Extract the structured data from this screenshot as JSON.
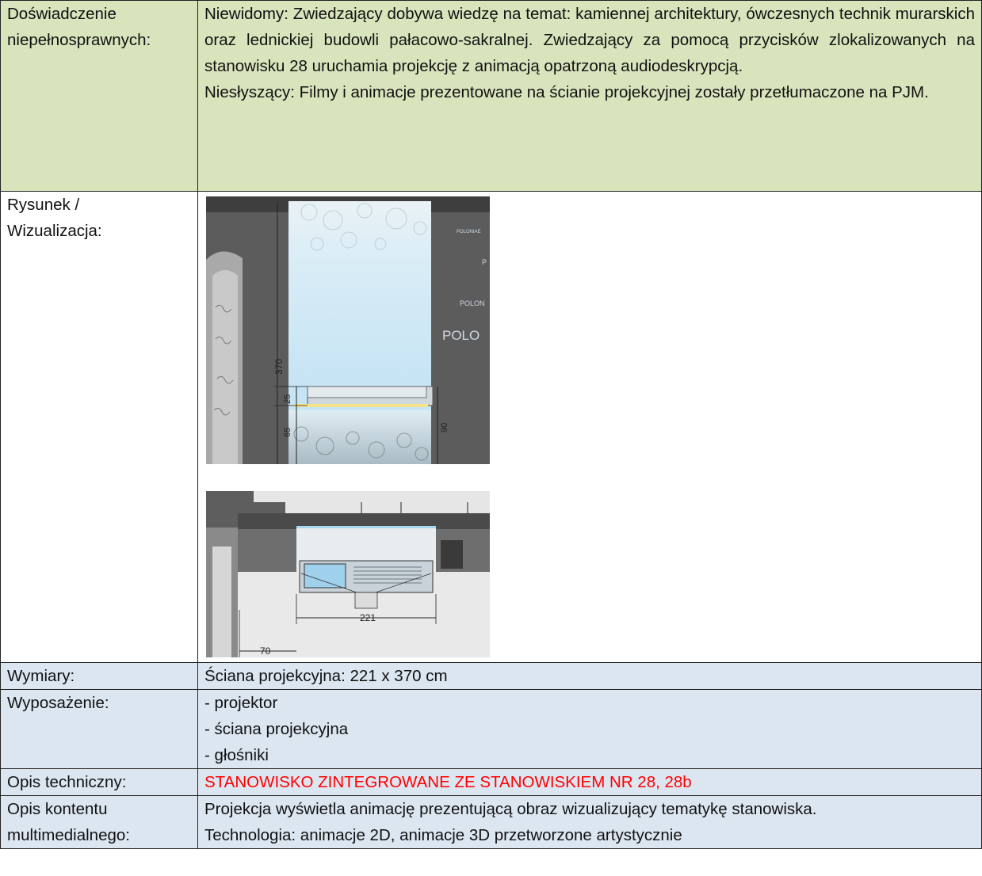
{
  "rows": {
    "experience": {
      "label_line1": "Doświadczenie",
      "label_line2": "niepełnosprawnych:",
      "blind": "Niewidomy: Zwiedzający dobywa wiedzę na temat: kamiennej architektury, ówczesnych technik murarskich oraz lednickiej budowli pałacowo-sakralnej. Zwiedzający za pomocą przycisków zlokalizowanych na stanowisku 28 uruchamia projekcję z animacją opatrzoną audiodeskrypcją.",
      "deaf": "Niesłyszący: Filmy i animacje prezentowane na ścianie projekcyjnej zostały przetłumaczone na PJM."
    },
    "drawing": {
      "label_line1": "Rysunek /",
      "label_line2": "Wizualizacja:",
      "elevation": {
        "dim_height": "370",
        "dim_25": "25",
        "dim_65": "65",
        "dim_90": "90",
        "wall_texts": [
          "POLONIAE",
          "P",
          "POLON",
          "POLO"
        ]
      },
      "plan": {
        "dim_221": "221",
        "dim_70": "70"
      }
    },
    "dimensions": {
      "label": "Wymiary:",
      "value": "Ściana projekcyjna: 221 x 370 cm"
    },
    "equipment": {
      "label": "Wyposażenie:",
      "items": [
        "- projektor",
        "- ściana projekcyjna",
        "- głośniki"
      ]
    },
    "technical": {
      "label": "Opis techniczny:",
      "value": "STANOWISKO ZINTEGROWANE ZE STANOWISKIEM NR 28, 28b",
      "value_color": "#ff0000"
    },
    "content": {
      "label_line1": "Opis kontentu",
      "label_line2": "multimedialnego:",
      "line1": "Projekcja wyświetla animację prezentującą obraz wizualizujący tematykę stanowiska.",
      "line2": "Technologia: animacje 2D, animacje 3D przetworzone artystycznie"
    }
  },
  "colors": {
    "green_row": "#d8e4bc",
    "blue_row": "#dce6f1",
    "wall_gray": "#5a5a5a"
  }
}
